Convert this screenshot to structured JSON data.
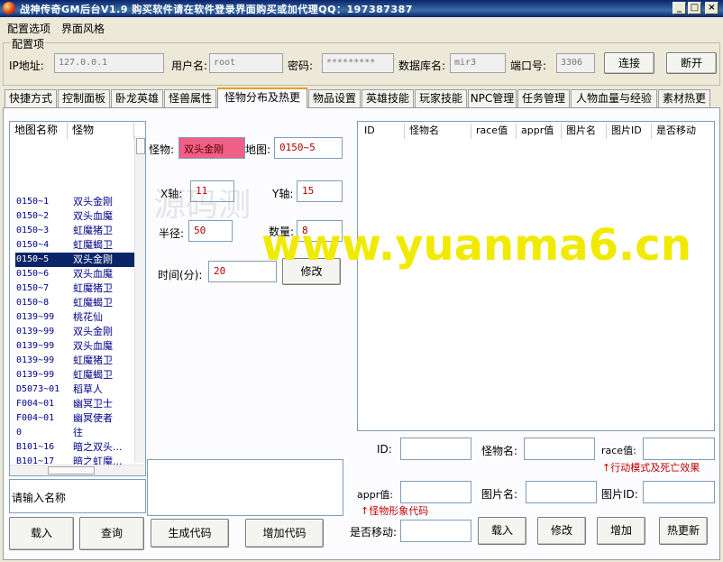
{
  "window": {
    "title": "战神传奇GM后台V1.9    购买软件请在软件登录界面购买或加代理QQ：197387387"
  },
  "menu": {
    "items": [
      "配置选项",
      "界面风格"
    ]
  },
  "config": {
    "legend": "配置项",
    "ip_label": "IP地址:",
    "ip_value": "127.0.0.1",
    "user_label": "用户名:",
    "user_value": "root",
    "pwd_label": "密码:",
    "pwd_value": "*********",
    "db_label": "数据库名:",
    "db_value": "mir3",
    "port_label": "端口号:",
    "port_value": "3306",
    "connect_label": "连接",
    "disconnect_label": "断开"
  },
  "tabs": [
    "快捷方式",
    "控制面板",
    "卧龙英雄",
    "怪兽属性",
    "怪物分布及热更",
    "物品设置",
    "英雄技能",
    "玩家技能",
    "NPC管理",
    "任务管理",
    "人物血量与经验",
    "素材热更"
  ],
  "active_tab": "怪物分布及热更",
  "list": {
    "headers": [
      "地图名称",
      "怪物"
    ],
    "rows": [
      [
        "0150~1",
        "双头金刚"
      ],
      [
        "0150~2",
        "双头血魔"
      ],
      [
        "0150~3",
        "虹魔猪卫"
      ],
      [
        "0150~4",
        "虹魔蝎卫"
      ],
      [
        "0150~5",
        "双头金刚"
      ],
      [
        "0150~6",
        "双头血魔"
      ],
      [
        "0150~7",
        "虹魔猪卫"
      ],
      [
        "0150~8",
        "虹魔蝎卫"
      ],
      [
        "0139~99",
        "桃花仙"
      ],
      [
        "0139~99",
        "双头金刚"
      ],
      [
        "0139~99",
        "双头血魔"
      ],
      [
        "0139~99",
        "虹魔猪卫"
      ],
      [
        "0139~99",
        "虹魔蝎卫"
      ],
      [
        "D5073~01",
        "稻草人"
      ],
      [
        "F004~01",
        "幽冥卫士"
      ],
      [
        "F004~01",
        "幽冥使者"
      ],
      [
        "0",
        "往"
      ],
      [
        "B101~16",
        "暗之双头..."
      ],
      [
        "B101~17",
        "暗之虹魔..."
      ]
    ],
    "selected_index": 4
  },
  "name_input_placeholder": "请输入名称",
  "form": {
    "monster_label": "怪物:",
    "monster_value": "双头金刚",
    "map_label": "地图:",
    "map_value": "0150~5",
    "x_label": "X轴:",
    "x_value": "11",
    "y_label": "Y轴:",
    "y_value": "15",
    "radius_label": "半径:",
    "radius_value": "50",
    "count_label": "数量:",
    "count_value": "8",
    "time_label": "时间(分):",
    "time_value": "20",
    "modify_label": "修改"
  },
  "grid": {
    "headers": [
      "ID",
      "怪物名",
      "race值",
      "appr值",
      "图片名",
      "图片ID",
      "是否移动"
    ]
  },
  "detail": {
    "id_label": "ID:",
    "name_label": "怪物名:",
    "race_label": "race值:",
    "race_note": "↑行动模式及死亡效果",
    "appr_label": "appr值:",
    "picname_label": "图片名:",
    "picid_label": "图片ID:",
    "appr_note": "↑怪物形象代码",
    "move_label": "是否移动:"
  },
  "buttons": {
    "load": "载入",
    "query": "查询",
    "gen_code": "生成代码",
    "add_code": "增加代码",
    "r_load": "载入",
    "r_modify": "修改",
    "r_add": "增加",
    "r_hot": "热更新"
  },
  "watermark": "www.yuanma6.cn",
  "watermark_faint": "源码测",
  "colors": {
    "title_bar": "#0a246a",
    "selection": "#0a246a",
    "monster_field": "#ef5f86",
    "watermark": "#f0ea00",
    "note": "#c00000"
  }
}
